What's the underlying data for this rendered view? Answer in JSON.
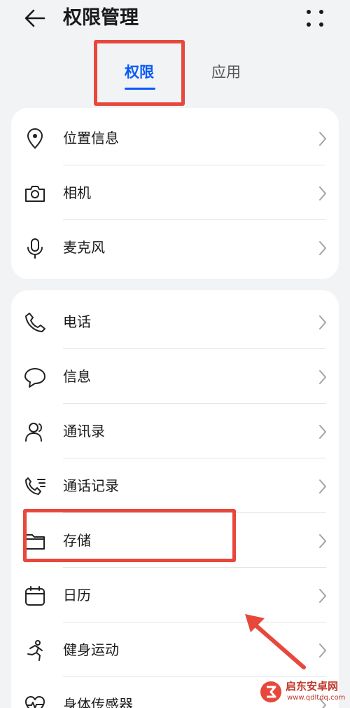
{
  "header": {
    "title": "权限管理",
    "back_icon": "back-arrow-icon",
    "more_icon": "more-dots-icon"
  },
  "tabs": [
    {
      "label": "权限",
      "active": true
    },
    {
      "label": "应用",
      "active": false
    }
  ],
  "group_primary": {
    "items": [
      {
        "label": "位置信息",
        "icon": "location-pin-icon"
      },
      {
        "label": "相机",
        "icon": "camera-icon"
      },
      {
        "label": "麦克风",
        "icon": "microphone-icon"
      }
    ]
  },
  "group_secondary": {
    "items": [
      {
        "label": "电话",
        "icon": "phone-icon"
      },
      {
        "label": "信息",
        "icon": "message-bubble-icon"
      },
      {
        "label": "通讯录",
        "icon": "contacts-icon"
      },
      {
        "label": "通话记录",
        "icon": "call-log-icon"
      },
      {
        "label": "存储",
        "icon": "folder-icon"
      },
      {
        "label": "日历",
        "icon": "calendar-icon"
      },
      {
        "label": "健身运动",
        "icon": "running-icon"
      },
      {
        "label": "身体传感器",
        "icon": "heart-rate-icon"
      }
    ]
  },
  "watermark": {
    "text": "启东安卓网",
    "url": "www.qdltdq.com"
  },
  "colors": {
    "accent": "#0a59f7",
    "annotation": "#e8473b",
    "background": "#f1f3f5",
    "card": "#ffffff"
  }
}
